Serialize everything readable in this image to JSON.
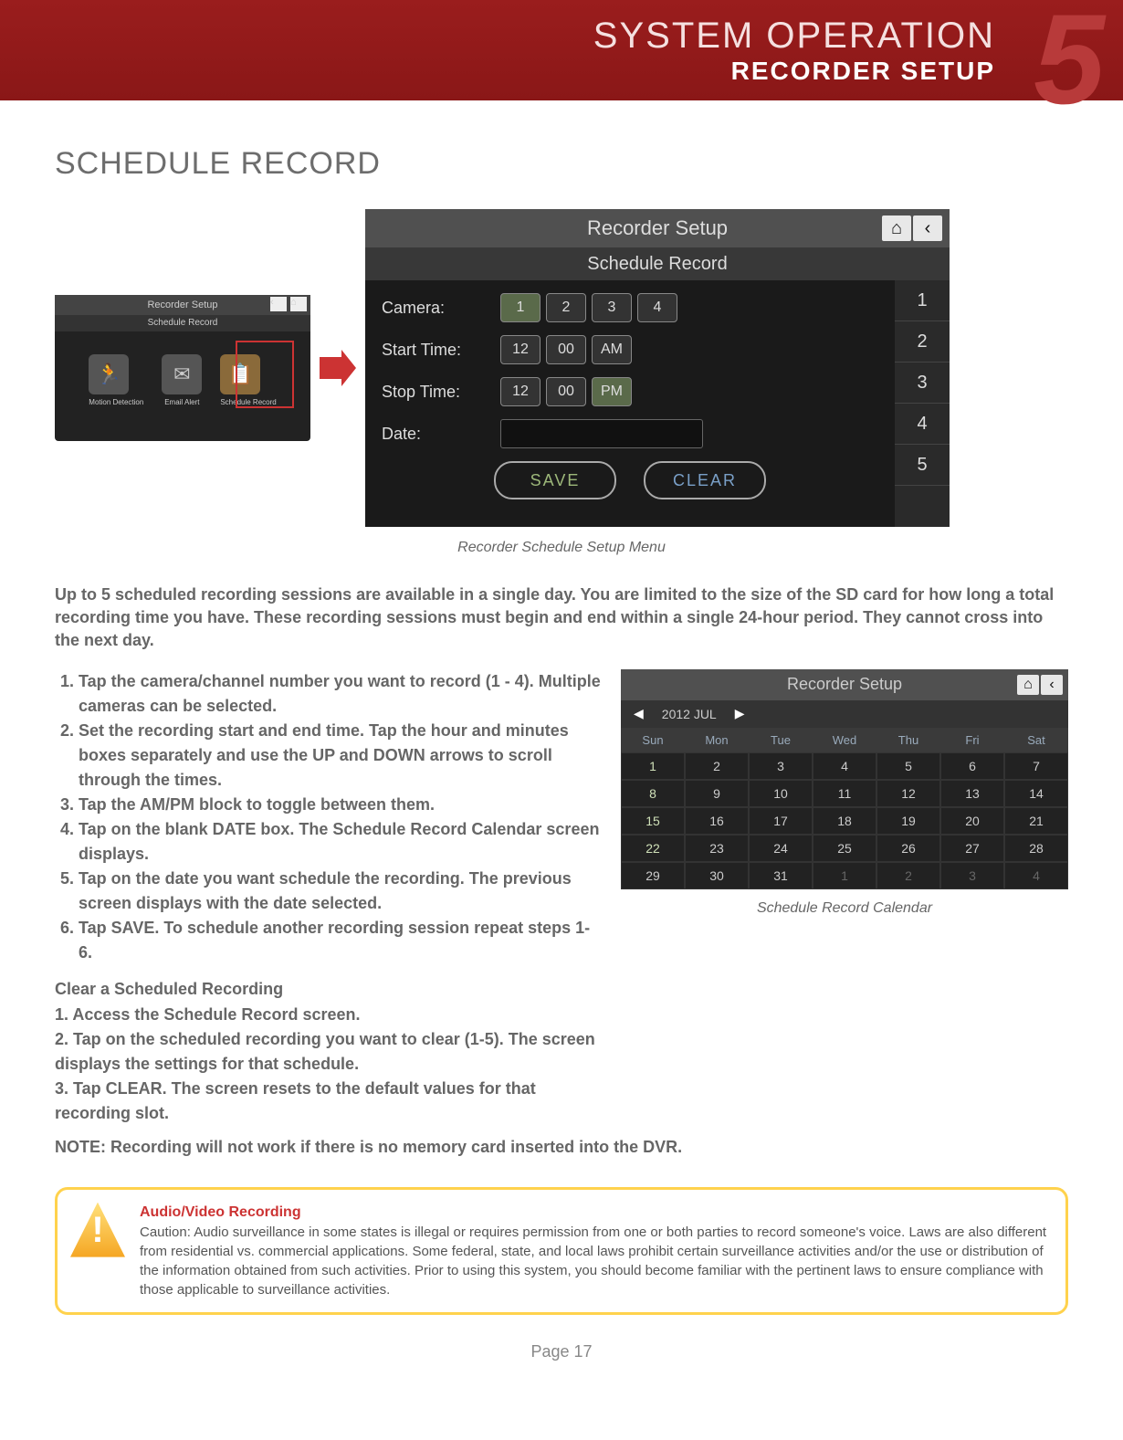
{
  "header": {
    "line1": "SYSTEM OPERATION",
    "line2": "RECORDER SETUP",
    "chapter": "5"
  },
  "title": "SCHEDULE RECORD",
  "thumb": {
    "title": "Recorder Setup",
    "subtitle": "Schedule Record",
    "icons": [
      "Motion Detection",
      "Email Alert",
      "Schedule Record"
    ]
  },
  "main": {
    "title": "Recorder Setup",
    "subtitle": "Schedule Record",
    "cameraLabel": "Camera:",
    "cameras": [
      "1",
      "2",
      "3",
      "4"
    ],
    "startLabel": "Start Time:",
    "start": [
      "12",
      "00",
      "AM"
    ],
    "stopLabel": "Stop Time:",
    "stop": [
      "12",
      "00",
      "PM"
    ],
    "dateLabel": "Date:",
    "save": "SAVE",
    "clear": "CLEAR",
    "slots": [
      "1",
      "2",
      "3",
      "4",
      "5"
    ]
  },
  "caption1": "Recorder Schedule Setup Menu",
  "intro": "Up to 5 scheduled recording sessions are available in a single day. You are limited to the size of the SD card for how long a total recording time you have. These recording sessions must begin and end within a single 24-hour period. They cannot cross into the next day.",
  "steps": [
    "Tap the camera/channel number you want to record (1 - 4). Multiple cameras can be selected.",
    "Set the recording start and end time. Tap the hour and minutes boxes separately and use the UP and DOWN arrows to scroll through the times.",
    "Tap the AM/PM block to toggle between them.",
    "Tap on the blank DATE box. The Schedule Record Calendar screen displays.",
    "Tap on the date you want schedule the recording. The previous screen displays with the date selected.",
    "Tap SAVE. To schedule another recording session repeat steps 1-6."
  ],
  "clearTitle": "Clear a Scheduled Recording",
  "clearSteps": [
    "1. Access the Schedule Record screen.",
    "2. Tap on the scheduled recording you want to clear (1-5). The screen displays the settings for that schedule.",
    "3. Tap CLEAR. The screen resets to the default values for that recording slot."
  ],
  "noteLine": "NOTE: Recording will not work if there is no memory card inserted into the DVR.",
  "cal": {
    "title": "Recorder Setup",
    "month": "2012 JUL",
    "days": [
      "Sun",
      "Mon",
      "Tue",
      "Wed",
      "Thu",
      "Fri",
      "Sat"
    ],
    "rows": [
      [
        "1",
        "2",
        "3",
        "4",
        "5",
        "6",
        "7"
      ],
      [
        "8",
        "9",
        "10",
        "11",
        "12",
        "13",
        "14"
      ],
      [
        "15",
        "16",
        "17",
        "18",
        "19",
        "20",
        "21"
      ],
      [
        "22",
        "23",
        "24",
        "25",
        "26",
        "27",
        "28"
      ],
      [
        "29",
        "30",
        "31",
        "1",
        "2",
        "3",
        "4"
      ]
    ]
  },
  "caption2": "Schedule Record Calendar",
  "warn": {
    "title": "Audio/Video Recording",
    "body": "Caution: Audio surveillance in some states is illegal or requires permission from one or both parties to record someone's voice. Laws are also different from residential vs. commercial applications. Some federal, state, and local laws prohibit certain surveillance activities and/or the use or distribution of the information obtained from such activities.  Prior to using this system, you should become familiar with the pertinent laws to ensure compliance with those applicable to surveillance activities."
  },
  "page": "Page 17"
}
